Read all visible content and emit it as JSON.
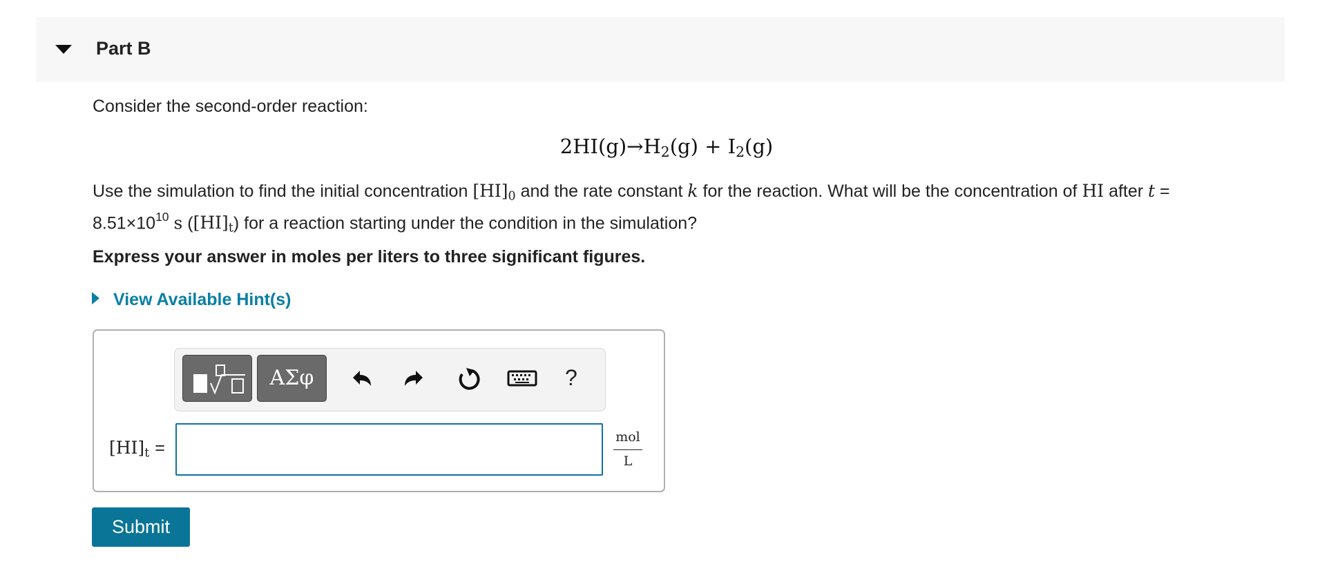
{
  "part": {
    "title": "Part B"
  },
  "question": {
    "intro": "Consider the second-order reaction:",
    "equation": {
      "reactant_coef": "2HI",
      "reactant_state": "(g)",
      "arrow": "→",
      "product1": "H",
      "product1_sub": "2",
      "product1_state": "(g)",
      "plus": "+",
      "product2": "I",
      "product2_sub": "2",
      "product2_state": "(g)"
    },
    "body": {
      "t1": "Use the simulation to find the initial concentration ",
      "hi0": "[HI]",
      "hi0_sub": "0",
      "t2": " and the rate constant ",
      "k": "k",
      "t3": " for the reaction. What will be the concentration of ",
      "hi": "HI",
      "t4": " after ",
      "t": "t",
      "t5": " =",
      "time_base": "8.51×10",
      "time_exp": "10",
      "time_unit": "s",
      "paren_open": " (",
      "hit": "[HI]",
      "hit_sub": "t",
      "t6": ") for a reaction starting under the condition in the simulation?"
    },
    "instruction": "Express your answer in moles per liters to three significant figures."
  },
  "hint_link": "View Available Hint(s)",
  "toolbar": {
    "templates_icon": "square-root-template-icon",
    "symbols_label": "ΑΣφ",
    "undo_icon": "undo-icon",
    "redo_icon": "redo-icon",
    "reset_icon": "reset-icon",
    "keyboard_icon": "keyboard-icon",
    "help_label": "?"
  },
  "answer": {
    "variable": "[HI]",
    "variable_sub": "t",
    "equals": "=",
    "value": "",
    "units_numerator": "mol",
    "units_denominator": "L"
  },
  "submit_label": "Submit"
}
